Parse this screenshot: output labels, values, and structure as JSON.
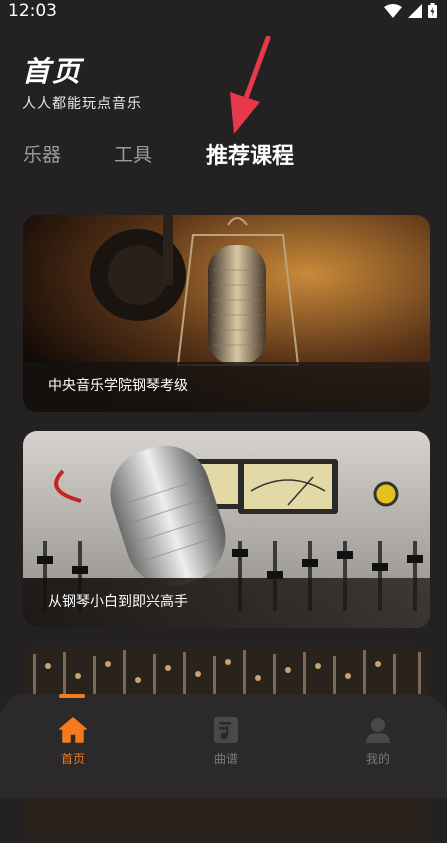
{
  "status_bar": {
    "time": "12:03"
  },
  "header": {
    "title": "首页",
    "subtitle": "人人都能玩点音乐"
  },
  "tabs": [
    {
      "label": "乐器"
    },
    {
      "label": "工具"
    },
    {
      "label": "推荐课程"
    }
  ],
  "courses": [
    {
      "label": "中央音乐学院钢琴考级"
    },
    {
      "label": "从钢琴小白到即兴高手"
    },
    {
      "label": ""
    }
  ],
  "bottom_nav": [
    {
      "label": "首页",
      "icon": "home-icon"
    },
    {
      "label": "曲谱",
      "icon": "sheet-music-icon"
    },
    {
      "label": "我的",
      "icon": "profile-icon"
    }
  ],
  "colors": {
    "accent": "#f47a1d",
    "background": "#232122",
    "nav_background": "#2b292a",
    "arrow": "#e6394a"
  }
}
